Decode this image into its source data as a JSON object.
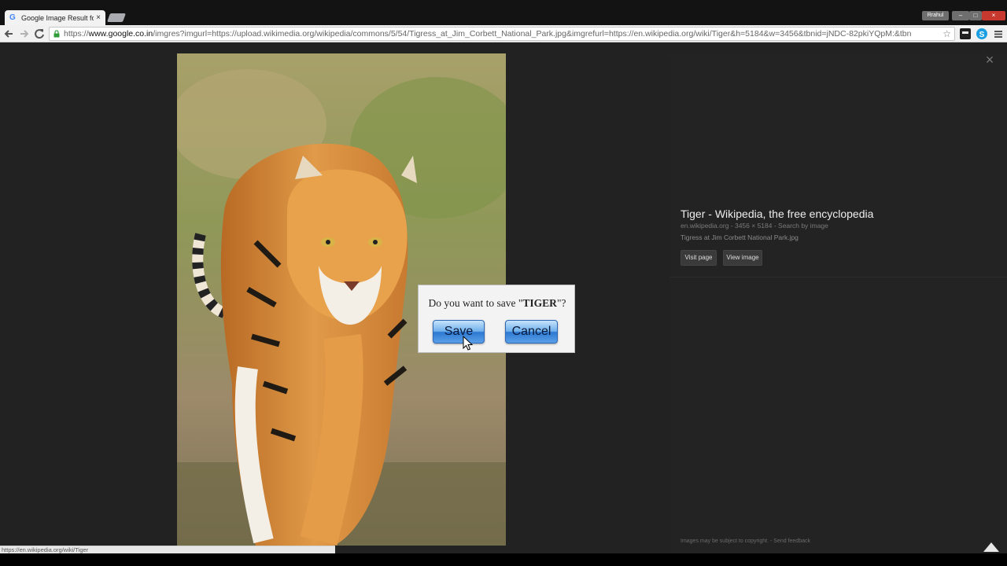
{
  "browser": {
    "tab_title": "Google Image Result for h",
    "tab_favicon": "G",
    "tab_close": "×",
    "user_name": "Rrahul",
    "window_minimize": "–",
    "window_maximize": "□",
    "window_close": "×",
    "address": {
      "scheme": "https://",
      "host": "www.google.co.in",
      "rest": "/imgres?imgurl=https://upload.wikimedia.org/wikipedia/commons/5/54/Tigress_at_Jim_Corbett_National_Park.jpg&imgrefurl=https://en.wikipedia.org/wiki/Tiger&h=5184&w=3456&tbnid=jNDC-82pkiYQpM:&tbn"
    },
    "icons": {
      "back": "back-arrow-icon",
      "forward": "forward-arrow-icon",
      "reload": "reload-icon",
      "lock": "lock-icon",
      "star": "bookmark-star-icon",
      "extension": "extension-icon",
      "skype": "skype-icon",
      "menu": "hamburger-menu-icon"
    },
    "status_url": "https://en.wikipedia.org/wiki/Tiger"
  },
  "viewer": {
    "image_subject": "tigress walking toward camera",
    "close_label": "×",
    "result": {
      "title": "Tiger - Wikipedia, the free encyclopedia",
      "meta": "en.wikipedia.org - 3456 × 5184 - Search by image",
      "caption": "Tigress at Jim Corbett National Park.jpg"
    },
    "buttons": {
      "visit_page": "Visit page",
      "view_image": "View image"
    },
    "footer": "Images may be subject to copyright. - Send feedback"
  },
  "dialog": {
    "question_prefix": "Do you want to save \"",
    "question_name": "TIGER",
    "question_suffix": "\"?",
    "save_label": "Save",
    "cancel_label": "Cancel"
  },
  "colors": {
    "viewer_bg": "#222222",
    "dialog_bg": "#f3f3f3",
    "button_blue": "#2d78d2"
  }
}
